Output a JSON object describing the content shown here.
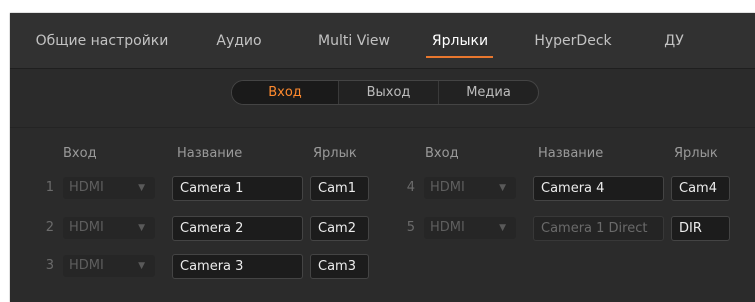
{
  "tabs": [
    {
      "label": "Общие настройки"
    },
    {
      "label": "Аудио"
    },
    {
      "label": "Multi View"
    },
    {
      "label": "Ярлыки",
      "active": true
    },
    {
      "label": "HyperDeck"
    },
    {
      "label": "ДУ"
    }
  ],
  "segments": [
    {
      "label": "Вход",
      "active": true
    },
    {
      "label": "Выход"
    },
    {
      "label": "Медиа"
    }
  ],
  "columns": {
    "input": "Вход",
    "name": "Название",
    "label": "Ярлык"
  },
  "rows": [
    {
      "num": "1",
      "source": "HDMI",
      "name": "Camera 1",
      "label": "Cam1"
    },
    {
      "num": "2",
      "source": "HDMI",
      "name": "Camera 2",
      "label": "Cam2"
    },
    {
      "num": "3",
      "source": "HDMI",
      "name": "Camera 3",
      "label": "Cam3"
    },
    {
      "num": "4",
      "source": "HDMI",
      "name": "Camera 4",
      "label": "Cam4"
    },
    {
      "num": "5",
      "source": "HDMI",
      "name": "Camera 1 Direct",
      "label": "DIR"
    }
  ],
  "colors": {
    "accent": "#e8772e",
    "panel": "#2b2b2b"
  },
  "icons": {
    "dropdown": "chevron-down-icon"
  }
}
